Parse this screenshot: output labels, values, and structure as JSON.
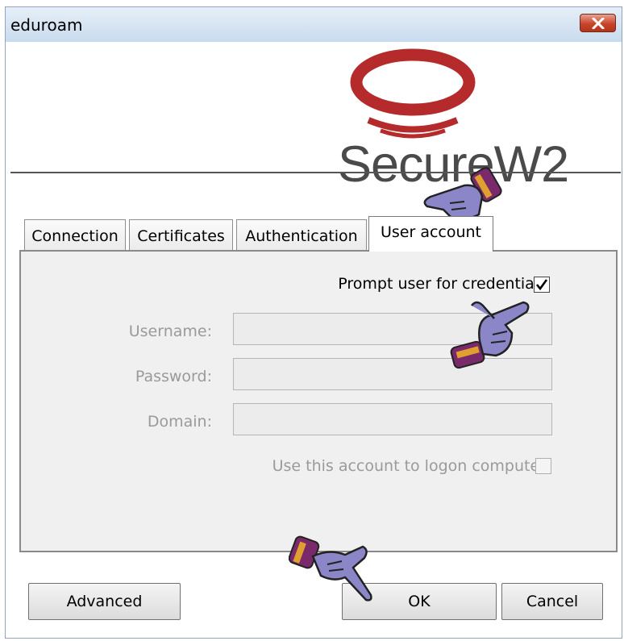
{
  "window": {
    "title": "eduroam",
    "logo_text": "SecureW2"
  },
  "tabs": [
    {
      "label": "Connection",
      "active": false
    },
    {
      "label": "Certificates",
      "active": false
    },
    {
      "label": "Authentication",
      "active": false
    },
    {
      "label": "User account",
      "active": true
    }
  ],
  "user_account": {
    "prompt_label": "Prompt user for credentials",
    "prompt_checked": true,
    "username_label": "Username:",
    "username_value": "",
    "password_label": "Password:",
    "password_value": "",
    "domain_label": "Domain:",
    "domain_value": "",
    "logon_label": "Use this account to logon computer",
    "logon_checked": false
  },
  "buttons": {
    "advanced": "Advanced",
    "ok": "OK",
    "cancel": "Cancel"
  },
  "colors": {
    "logo_red": "#b52a2a",
    "logo_text": "#4a4a4a",
    "title_bar": "#c9dbee",
    "close_button": "#c8452c"
  },
  "icons": [
    "close-icon",
    "securew2-logo",
    "pointing-hand-icon",
    "checkmark-icon"
  ]
}
